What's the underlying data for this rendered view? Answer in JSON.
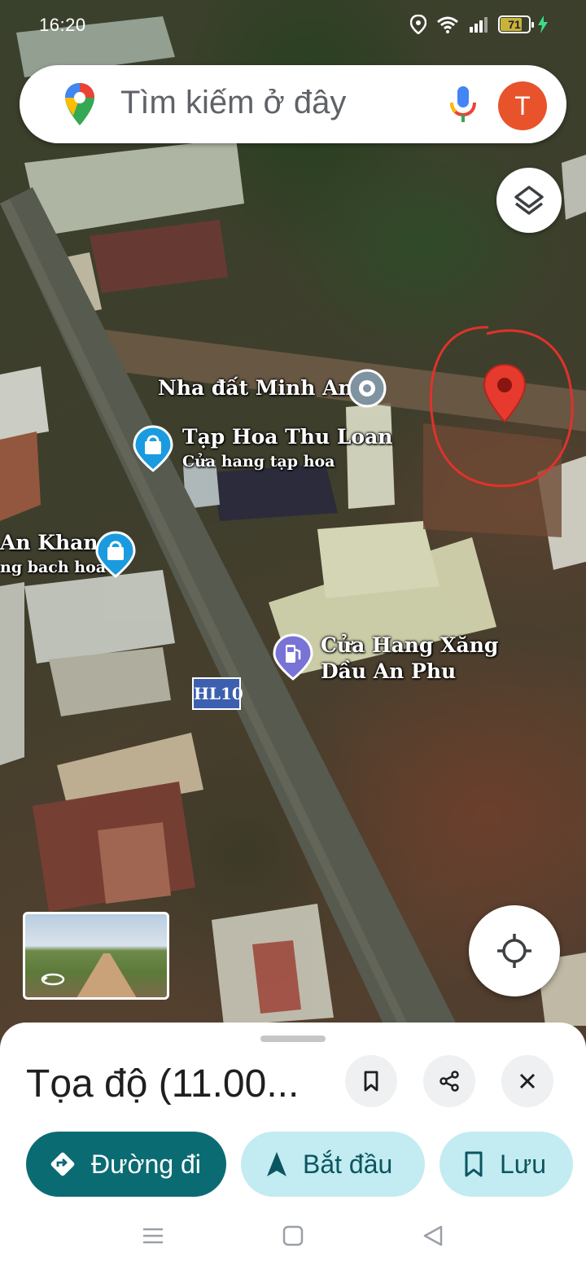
{
  "status_bar": {
    "time": "16:20",
    "battery": "71"
  },
  "search": {
    "placeholder": "Tìm kiếm ở đây",
    "avatar_letter": "T"
  },
  "map": {
    "labels": {
      "nha_dat_minh_anh": "Nha đất Minh Anh",
      "tap_hoa_title": "Tạp Hoa Thu Loan",
      "tap_hoa_subtitle": "Cửa hang tạp hoa",
      "an_khang_title": "An Khang",
      "an_khang_subtitle": "ng bach hoa",
      "gas_station_line1": "Cửa Hang Xăng",
      "gas_station_line2": "Dầu An Phu"
    },
    "road_shield": "HL10"
  },
  "place": {
    "title": "Tọa độ (11.00..."
  },
  "actions": {
    "directions": "Đường đi",
    "start": "Bắt đầu",
    "save": "Lưu"
  },
  "colors": {
    "accent": "#0b6b73",
    "chip_bg": "#c2ecf1",
    "pin_red": "#e53a2d",
    "avatar": "#e8532b"
  }
}
